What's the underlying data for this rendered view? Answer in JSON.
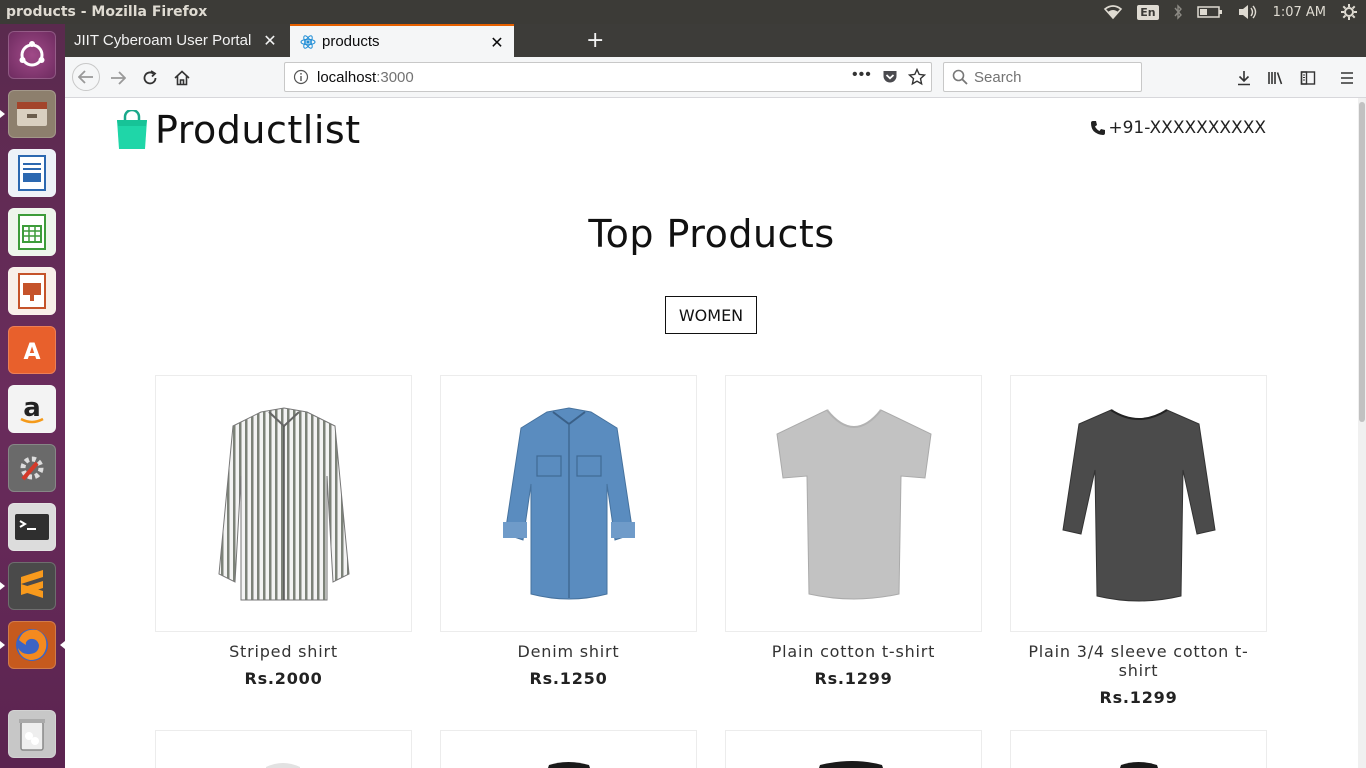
{
  "os": {
    "window_title": "products - Mozilla Firefox",
    "keyboard_lang": "En",
    "clock": "1:07 AM"
  },
  "launcher": {
    "apps": [
      {
        "name": "ubuntu-dash",
        "color": "#d54a21"
      },
      {
        "name": "files",
        "color": "#8a7a66"
      },
      {
        "name": "libreoffice-writer",
        "color": "#2c68b0"
      },
      {
        "name": "libreoffice-calc",
        "color": "#3d9c3a"
      },
      {
        "name": "libreoffice-impress",
        "color": "#c5532a"
      },
      {
        "name": "ubuntu-software",
        "color": "#e8602c"
      },
      {
        "name": "amazon",
        "color": "#f3f3f3"
      },
      {
        "name": "system-settings",
        "color": "#777777"
      },
      {
        "name": "terminal",
        "color": "#2f2f2f"
      },
      {
        "name": "sublime-text",
        "color": "#4a4a4a"
      },
      {
        "name": "firefox",
        "color": "#e66000"
      },
      {
        "name": "trash",
        "color": "#bdbdbd"
      }
    ]
  },
  "browser": {
    "tabs": [
      {
        "label": "JIIT Cyberoam User Portal",
        "active": false
      },
      {
        "label": "products",
        "active": true
      }
    ],
    "url_host": "localhost",
    "url_port": ":3000",
    "search_placeholder": "Search"
  },
  "site": {
    "brand": "Productlist",
    "phone": "+91-XXXXXXXXXX",
    "section_title": "Top Products",
    "filter_label": "WOMEN",
    "products": [
      {
        "name": "Striped shirt",
        "price": "Rs.2000"
      },
      {
        "name": "Denim shirt",
        "price": "Rs.1250"
      },
      {
        "name": "Plain cotton t-shirt",
        "price": "Rs.1299"
      },
      {
        "name": "Plain 3/4 sleeve cotton t-shirt",
        "price": "Rs.1299"
      }
    ]
  },
  "colors": {
    "accent_tab": "#e66000",
    "launcher_bg": "#5a2a4e",
    "bag_icon": "#1fd6a8"
  }
}
